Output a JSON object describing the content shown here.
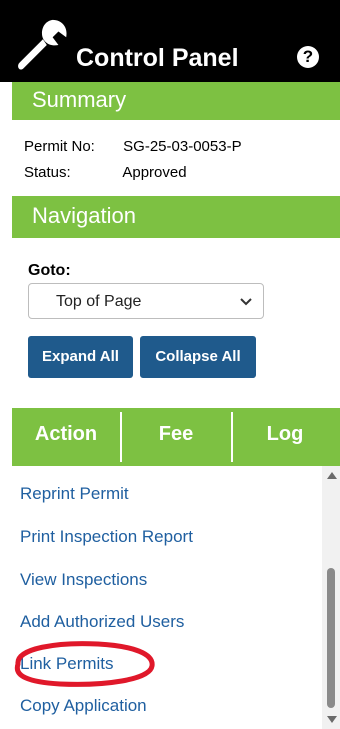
{
  "header": {
    "title": "Control Panel",
    "help_glyph": "?",
    "wrench_icon": "wrench-icon",
    "help_icon": "help-icon"
  },
  "summary": {
    "title": "Summary",
    "permit_label": "Permit No:",
    "permit_value": "SG-25-03-0053-P",
    "status_label": "Status:",
    "status_value": "Approved"
  },
  "navigation": {
    "title": "Navigation",
    "goto_label": "Goto:",
    "goto_value": "Top of Page",
    "expand_label": "Expand All",
    "collapse_label": "Collapse All"
  },
  "tabs": [
    {
      "label": "Action"
    },
    {
      "label": "Fee"
    },
    {
      "label": "Log"
    }
  ],
  "actions": [
    {
      "label": "Reprint Permit"
    },
    {
      "label": "Print Inspection Report"
    },
    {
      "label": "View Inspections"
    },
    {
      "label": "Add Authorized Users"
    },
    {
      "label": "Link Permits"
    },
    {
      "label": "Copy Application"
    }
  ],
  "colors": {
    "green": "#7dc142",
    "blue_button": "#1f5a8c",
    "link": "#1f5fa0",
    "highlight": "#e0182a"
  }
}
